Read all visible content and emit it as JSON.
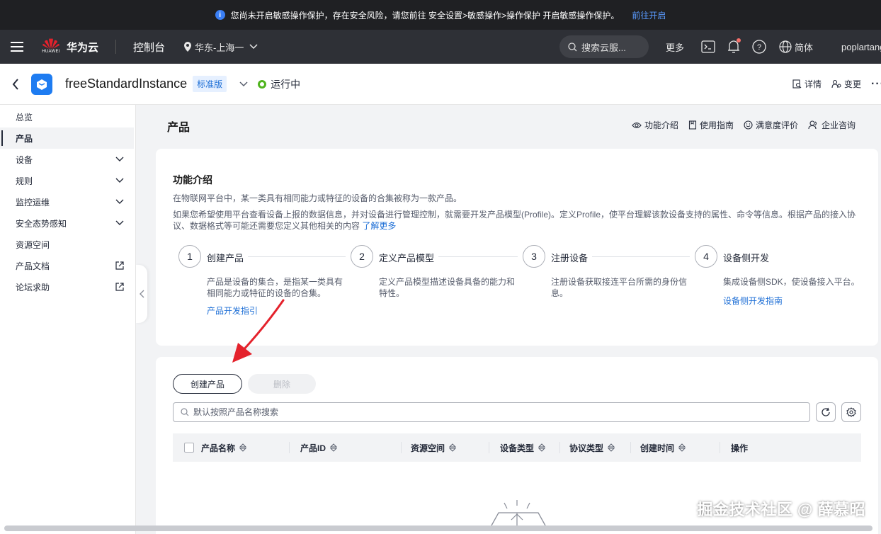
{
  "banner": {
    "message": "您尚未开启敏感操作保护，存在安全风险，请您前往 安全设置>敏感操作>操作保护 开启敏感操作保护。",
    "link": "前往开启"
  },
  "topnav": {
    "logo_sub": "HUAWEI",
    "brand": "华为云",
    "console": "控制台",
    "region": "华东-上海一",
    "search_placeholder": "搜索云服...",
    "more": "更多",
    "language": "简体",
    "user": "poplartang"
  },
  "instance": {
    "name": "freeStandardInstance",
    "edition": "标准版",
    "status": "运行中",
    "detail": "详情",
    "change": "变更",
    "more": "···"
  },
  "sidebar": {
    "items": [
      {
        "label": "总览"
      },
      {
        "label": "产品"
      },
      {
        "label": "设备"
      },
      {
        "label": "规则"
      },
      {
        "label": "监控运维"
      },
      {
        "label": "安全态势感知"
      },
      {
        "label": "资源空间"
      },
      {
        "label": "产品文档"
      },
      {
        "label": "论坛求助"
      }
    ]
  },
  "page": {
    "title": "产品",
    "links": [
      "功能介绍",
      "使用指南",
      "满意度评价",
      "企业咨询"
    ]
  },
  "intro": {
    "title": "功能介绍",
    "p1": "在物联网平台中，某一类具有相同能力或特征的设备的合集被称为一款产品。",
    "p2": "如果您希望使用平台查看设备上报的数据信息，并对设备进行管理控制，就需要开发产品模型(Profile)。定义Profile，使平台理解该款设备支持的属性、命令等信息。根据产品的接入协议、数据格式等可能还需要您定义其他相关的内容",
    "learn_more": "了解更多",
    "steps": [
      {
        "num": "1",
        "name": "创建产品",
        "desc": "产品是设备的集合，是指某一类具有相同能力或特征的设备的合集。",
        "guide": "产品开发指引"
      },
      {
        "num": "2",
        "name": "定义产品模型",
        "desc": "定义产品模型描述设备具备的能力和特性。",
        "guide": ""
      },
      {
        "num": "3",
        "name": "注册设备",
        "desc": "注册设备获取接连平台所需的身份信息。",
        "guide": ""
      },
      {
        "num": "4",
        "name": "设备侧开发",
        "desc": "集成设备侧SDK，使设备接入平台。",
        "guide": "设备侧开发指南"
      }
    ]
  },
  "list": {
    "create": "创建产品",
    "delete": "删除",
    "search_placeholder": "默认按照产品名称搜索",
    "columns": [
      "产品名称",
      "产品ID",
      "资源空间",
      "设备类型",
      "协议类型",
      "创建时间",
      "操作"
    ]
  },
  "watermark": "掘金技术社区 @ 薛慕昭",
  "colors": {
    "accent": "#1e6fd6",
    "status_ok": "#50b41e",
    "nav_bg": "#2e3036",
    "banner_bg": "#1f2023",
    "arrow": "#e4222c"
  }
}
